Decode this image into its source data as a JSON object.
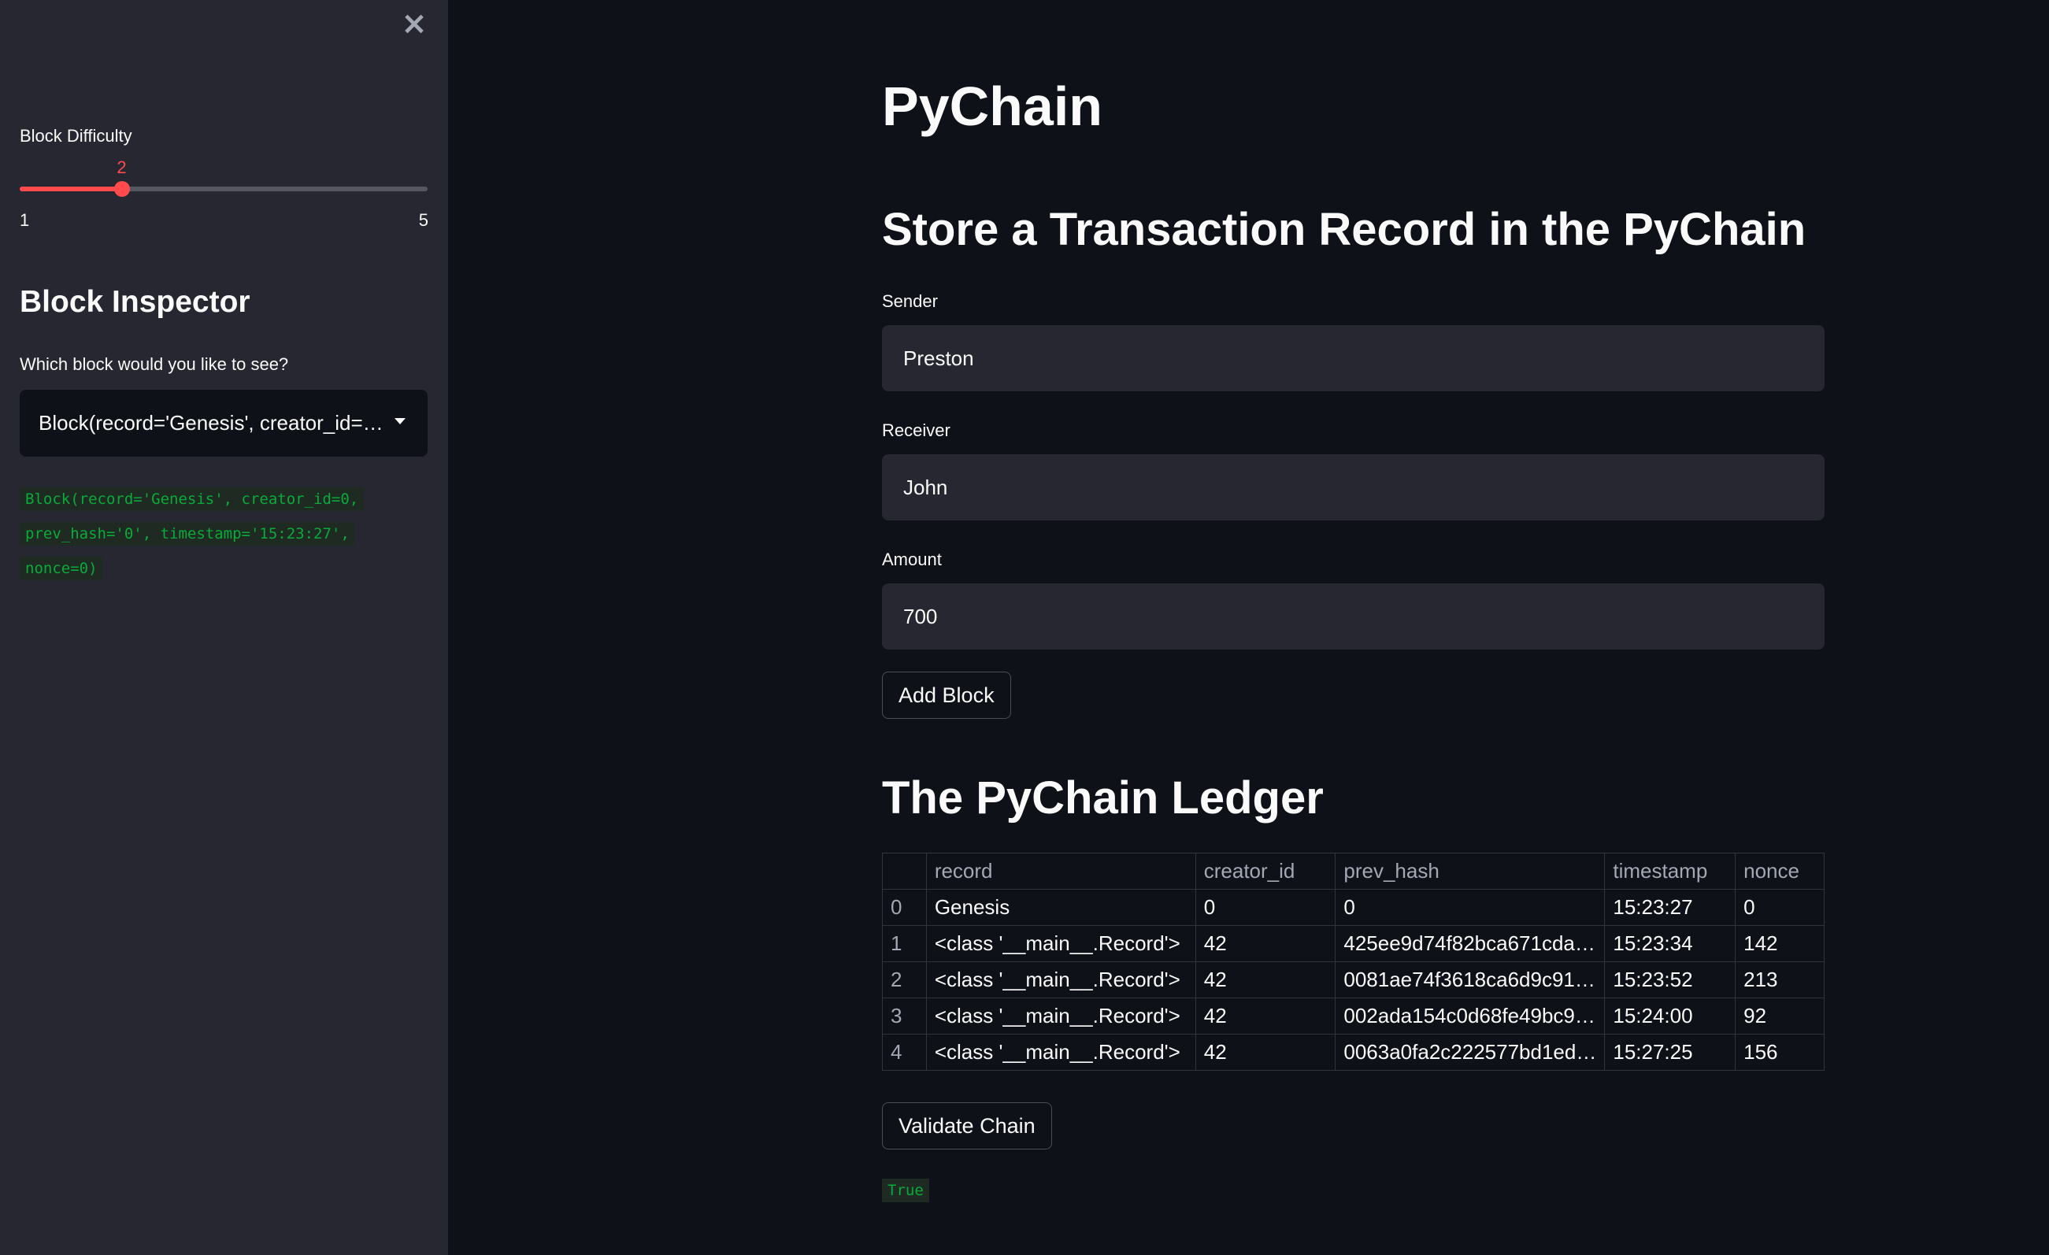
{
  "sidebar": {
    "close_symbol": "×",
    "slider": {
      "label": "Block Difficulty",
      "value": 2,
      "value_text": "2",
      "min": 1,
      "max": 5,
      "min_text": "1",
      "max_text": "5"
    },
    "inspector_title": "Block Inspector",
    "select_label": "Which block would you like to see?",
    "select_value": "Block(record='Genesis', creator_id=0, prev_hash='0', timestamp='15:23:27', nonce=0)",
    "output_lines": [
      "Block(record='Genesis', creator_id=0,",
      "prev_hash='0', timestamp='15:23:27',",
      "nonce=0)"
    ]
  },
  "main": {
    "title": "PyChain",
    "store_title": "Store a Transaction Record in the PyChain",
    "sender": {
      "label": "Sender",
      "value": "Preston"
    },
    "receiver": {
      "label": "Receiver",
      "value": "John"
    },
    "amount": {
      "label": "Amount",
      "value": "700"
    },
    "add_block_label": "Add Block",
    "ledger_title": "The PyChain Ledger",
    "ledger": {
      "columns": [
        "",
        "record",
        "creator_id",
        "prev_hash",
        "timestamp",
        "nonce"
      ],
      "rows": [
        [
          "0",
          "Genesis",
          "0",
          "0",
          "15:23:27",
          "0"
        ],
        [
          "1",
          "<class '__main__.Record'>",
          "42",
          "425ee9d74f82bca671cda…",
          "15:23:34",
          "142"
        ],
        [
          "2",
          "<class '__main__.Record'>",
          "42",
          "0081ae74f3618ca6d9c91…",
          "15:23:52",
          "213"
        ],
        [
          "3",
          "<class '__main__.Record'>",
          "42",
          "002ada154c0d68fe49bc9…",
          "15:24:00",
          "92"
        ],
        [
          "4",
          "<class '__main__.Record'>",
          "42",
          "0063a0fa2c222577bd1ed…",
          "15:27:25",
          "156"
        ]
      ]
    },
    "validate_label": "Validate Chain",
    "validate_result": "True"
  },
  "colors": {
    "background": "#0e1117",
    "sidebar": "#262730",
    "accent": "#ff4b4b",
    "code_green": "#09ab3b"
  }
}
